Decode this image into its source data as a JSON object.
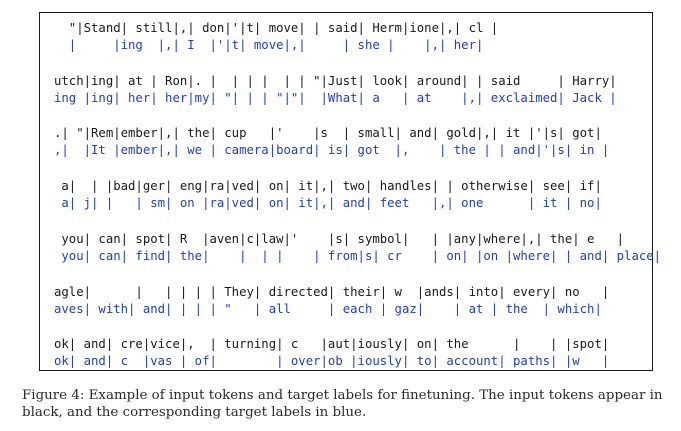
{
  "figure": {
    "blocks": [
      {
        "input": "  \"|Stand| still|,| don|'|t| move| | said| Herm|ione|,| cl |",
        "target": "  |     |ing  |,| I  |'|t| move|,|     | she |    |,| her|"
      },
      {
        "input": "utch|ing| at | Ron|. |  | | |  | | \"|Just| look| around| | said     | Harry|",
        "target": "ing |ing| her| her|my| \"| | | \"|\"|  |What| a   | at    |,| exclaimed| Jack |"
      },
      {
        "input": ".| \"|Rem|ember|,| the| cup   |'    |s  | small| and| gold|,| it |'|s| got|",
        "target": ",|  |It |ember|,| we | camera|board| is| got  |,    | the | | and|'|s| in |"
      },
      {
        "input": " a|  | |bad|ger| eng|ra|ved| on| it|,| two| handles| | otherwise| see| if|",
        "target": " a| j| |   | sm| on |ra|ved| on| it|,| and| feet   |,| one      | it | no|"
      },
      {
        "input": " you| can| spot| R  |aven|c|law|'    |s| symbol|   | |any|where|,| the| e   |",
        "target": " you| can| find| the|    |  | |    | from|s| cr    | on| |on |where| | and| place|"
      },
      {
        "input": "agle|      |   | | | | They| directed| their| w  |ands| into| every| no   |",
        "target": "aves| with| and| | | | \"   | all     | each | gaz|    | at | the  | which|"
      },
      {
        "input": "ok| and| cre|vice|,  | turning| c   |aut|iously| on| the      |    | |spot|",
        "target": "ok| and| c  |vas | of|        | over|ob |iously| to| account| paths| |w   |"
      }
    ],
    "caption": "Figure 4: Example of input tokens and target labels for finetuning. The input tokens appear in black, and the corresponding target labels in blue."
  },
  "colors": {
    "input_text": "#1a1a1a",
    "target_text": "#1f3fbf",
    "border": "#1a1a1a"
  }
}
